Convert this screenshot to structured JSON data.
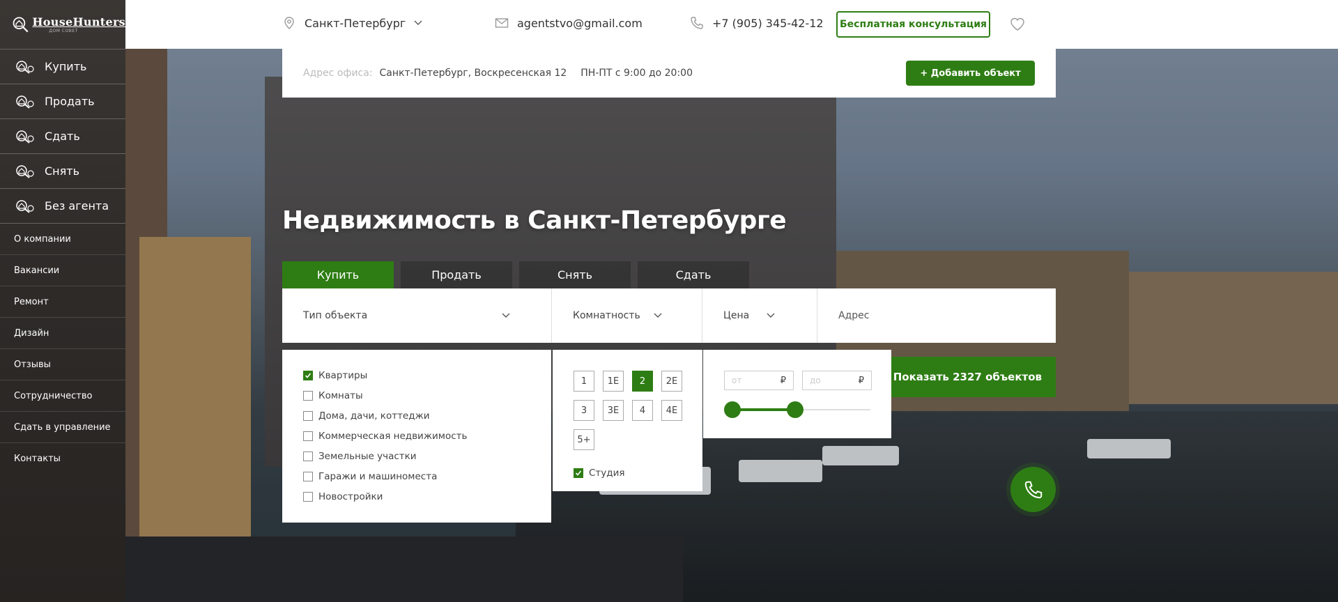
{
  "brand": {
    "name": "HouseHunters",
    "tagline": "ДОМ СОВЕТ"
  },
  "sidebar": {
    "main_items": [
      {
        "label": "Купить",
        "icon": "house-search-icon"
      },
      {
        "label": "Продать",
        "icon": "house-search-icon"
      },
      {
        "label": "Сдать",
        "icon": "house-search-icon"
      },
      {
        "label": "Снять",
        "icon": "house-search-icon"
      },
      {
        "label": "Без агента",
        "icon": "house-search-icon"
      }
    ],
    "sub_items": [
      "О компании",
      "Вакансии",
      "Ремонт",
      "Дизайн",
      "Отзывы",
      "Сотрудничество",
      "Сдать в управление",
      "Контакты"
    ]
  },
  "topbar": {
    "city": "Санкт-Петербург",
    "email": "agentstvo@gmail.com",
    "phone": "+7 (905) 345-42-12",
    "consult_label": "Бесплатная консультация"
  },
  "office": {
    "label": "Адрес офиса:",
    "address": "Санкт-Петербург, Воскресенская 12",
    "hours": "ПН-ПТ с 9:00 до 20:00",
    "add_label": "+ Добавить объект"
  },
  "hero": {
    "title": "Недвижимость в Санкт-Петербурге"
  },
  "tabs": [
    "Купить",
    "Продать",
    "Снять",
    "Сдать"
  ],
  "active_tab": "Купить",
  "filters": {
    "type": "Тип объекта",
    "rooms": "Комнатность",
    "price": "Цена",
    "address": "Адрес"
  },
  "property_types": [
    {
      "label": "Квартиры",
      "checked": true
    },
    {
      "label": "Комнаты",
      "checked": false
    },
    {
      "label": "Дома, дачи, коттеджи",
      "checked": false
    },
    {
      "label": "Коммерческая недвижимость",
      "checked": false
    },
    {
      "label": "Земельные участки",
      "checked": false
    },
    {
      "label": "Гаражи и машиноместа",
      "checked": false
    },
    {
      "label": "Новостройки",
      "checked": false
    }
  ],
  "rooms": {
    "options": [
      "1",
      "1Е",
      "2",
      "2Е",
      "3",
      "3Е",
      "4",
      "4Е",
      "5+"
    ],
    "selected": "2",
    "studio_label": "Студия",
    "studio_checked": true
  },
  "price": {
    "from_placeholder": "от",
    "to_placeholder": "до",
    "currency": "₽"
  },
  "show_button": "Показать 2327 объектов",
  "colors": {
    "accent": "#2e7d14",
    "sidebar_bg": "#2e2b29"
  }
}
